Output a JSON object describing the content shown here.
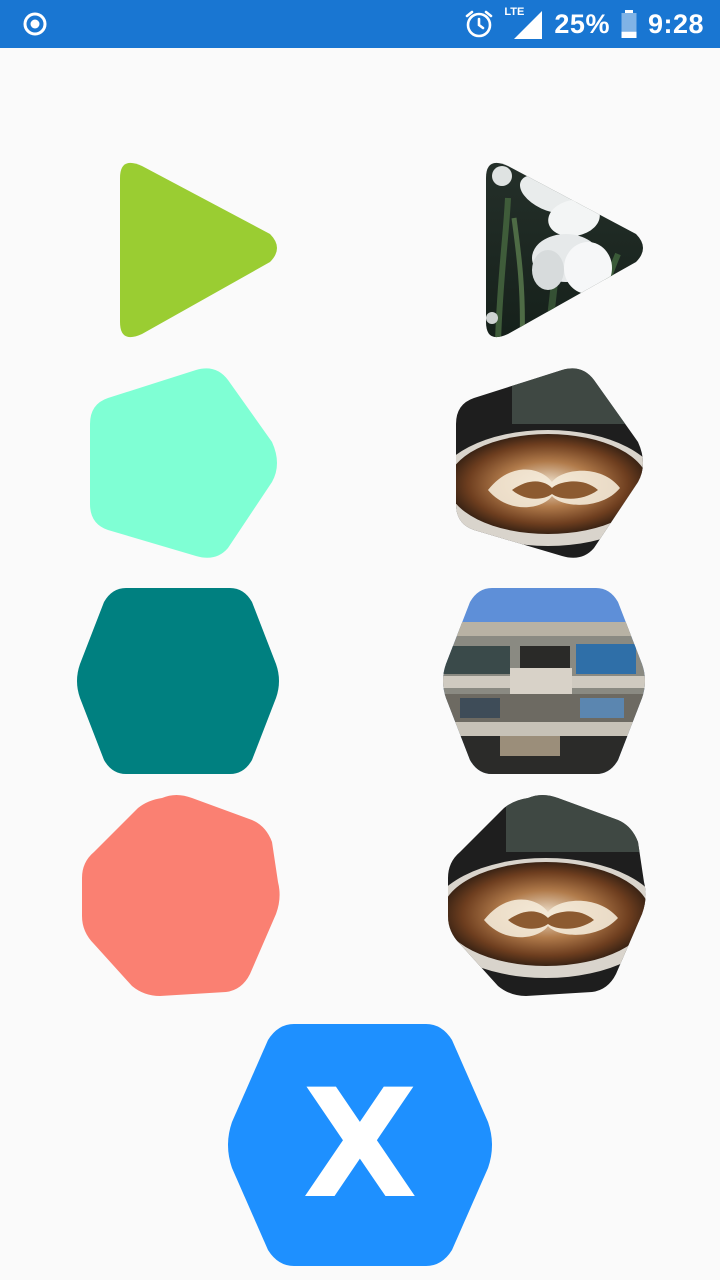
{
  "status_bar": {
    "battery_percent": "25%",
    "time": "9:28",
    "network": "LTE",
    "battery_level": 0.25,
    "background_color": "#1976d2",
    "icons": [
      "record-icon",
      "alarm-clock-icon",
      "signal-lte-icon",
      "battery-icon"
    ]
  },
  "shapes": {
    "left_column": [
      {
        "type": "triangle",
        "sides": 3,
        "fill": "#9acd32"
      },
      {
        "type": "pentagon",
        "sides": 5,
        "fill": "#7fffd4"
      },
      {
        "type": "hexagon",
        "sides": 6,
        "fill": "#008080"
      },
      {
        "type": "heptagon",
        "sides": 7,
        "fill": "#fa8072"
      }
    ],
    "right_column": [
      {
        "type": "triangle",
        "sides": 3,
        "image": "white-tulips-photo"
      },
      {
        "type": "pentagon",
        "sides": 5,
        "image": "latte-art-photo"
      },
      {
        "type": "hexagon",
        "sides": 6,
        "image": "apartment-building-photo"
      },
      {
        "type": "heptagon",
        "sides": 7,
        "image": "latte-art-photo"
      }
    ]
  },
  "fab": {
    "label": "X",
    "fill": "#1e90ff",
    "shape": "hexagon"
  }
}
